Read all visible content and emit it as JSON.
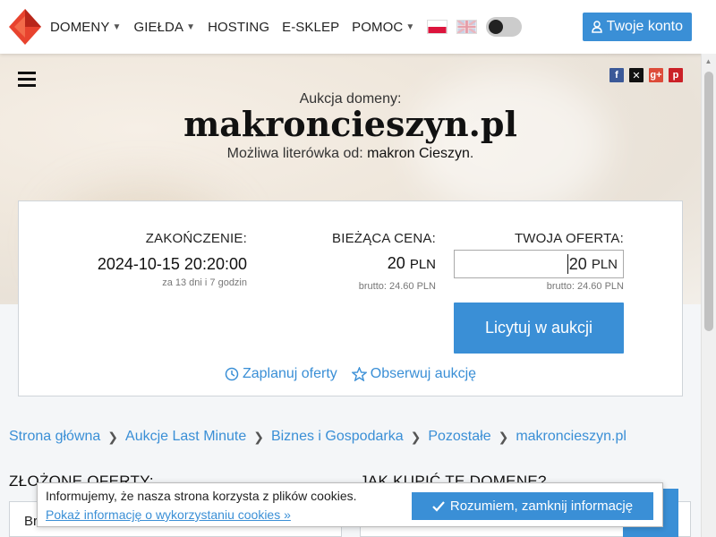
{
  "nav": {
    "items": [
      {
        "label": "DOMENY",
        "dropdown": true
      },
      {
        "label": "GIEŁDA",
        "dropdown": true
      },
      {
        "label": "HOSTING",
        "dropdown": false
      },
      {
        "label": "E-SKLEP",
        "dropdown": false
      },
      {
        "label": "POMOC",
        "dropdown": true
      }
    ],
    "account_label": "Twoje konto",
    "brand_color": "#e8432e",
    "accent_color": "#3a8fd6"
  },
  "hero": {
    "label": "Aukcja domeny:",
    "domain": "makroncieszyn.pl",
    "typo_prefix": "Możliwa literówka od:",
    "typo_value": "makron Cieszyn",
    "typo_suffix": "."
  },
  "auction": {
    "end_label": "ZAKOŃCZENIE:",
    "end_value": "2024-10-15 20:20:00",
    "end_remaining": "za 13 dni i 7 godzin",
    "price_label": "BIEŻĄCA CENA:",
    "price_value": "20",
    "price_currency": "PLN",
    "price_gross": "brutto: 24.60 PLN",
    "offer_label": "TWOJA OFERTA:",
    "offer_value": "20",
    "offer_currency": "PLN",
    "offer_gross": "brutto: 24.60 PLN",
    "bid_button": "Licytuj w aukcji",
    "plan_link": "Zaplanuj oferty",
    "watch_link": "Obserwuj aukcję"
  },
  "breadcrumb": [
    "Strona główna",
    "Aukcje Last Minute",
    "Biznes i Gospodarka",
    "Pozostałe",
    "makroncieszyn.pl"
  ],
  "sections": {
    "left_title": "ZŁOŻONE OFERTY:",
    "right_title": "JAK KUPIĆ TĘ DOMENĘ?",
    "left_first_text": "Br"
  },
  "cookie": {
    "text": "Informujemy, że nasza strona korzysta z plików cookies.",
    "link": "Pokaż informację o wykorzystaniu cookies »",
    "button": "Rozumiem, zamknij informację"
  }
}
